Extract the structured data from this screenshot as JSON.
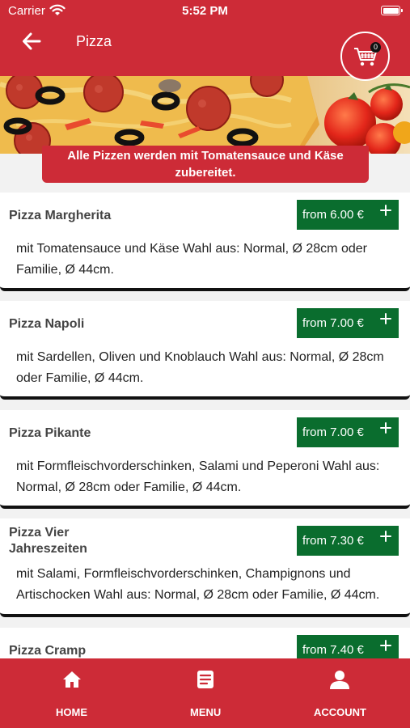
{
  "status_bar": {
    "carrier": "Carrier",
    "time": "5:52 PM"
  },
  "nav": {
    "title": "Pizza",
    "cart_count": "0"
  },
  "notice": {
    "text": "Alle Pizzen werden mit Tomatensauce und Käse zubereitet."
  },
  "products": [
    {
      "name": "Pizza Margherita",
      "price": "from 6.00 €",
      "description": "mit Tomatensauce und Käse  Wahl aus: Normal, Ø 28cm oder Familie, Ø 44cm."
    },
    {
      "name": "Pizza Napoli",
      "price": "from 7.00 €",
      "description": "mit Sardellen, Oliven und Knoblauch  Wahl aus: Normal, Ø 28cm oder Familie, Ø 44cm."
    },
    {
      "name": "Pizza Pikante",
      "price": "from 7.00 €",
      "description": "mit Formfleischvorderschinken, Salami und Peperoni  Wahl aus: Normal, Ø 28cm oder Familie, Ø 44cm."
    },
    {
      "name": "Pizza Vier Jahreszeiten",
      "price": "from 7.30 €",
      "description": "mit Salami, Formfleischvorderschinken, Champignons und Artischocken  Wahl aus: Normal, Ø 28cm oder Familie, Ø 44cm."
    },
    {
      "name": "Pizza Cramp",
      "price": "from 7.40 €",
      "description": ""
    }
  ],
  "tabbar": {
    "home": "HOME",
    "menu": "MENU",
    "account": "ACCOUNT"
  },
  "colors": {
    "brand_red": "#cd2b37",
    "price_green": "#0a6d2e",
    "background": "#f2f2f2"
  },
  "icons": {
    "back": "arrow-left-icon",
    "cart": "shopping-cart-icon",
    "plus": "plus-icon",
    "home": "home-icon",
    "menu": "menu-list-icon",
    "account": "user-icon"
  }
}
